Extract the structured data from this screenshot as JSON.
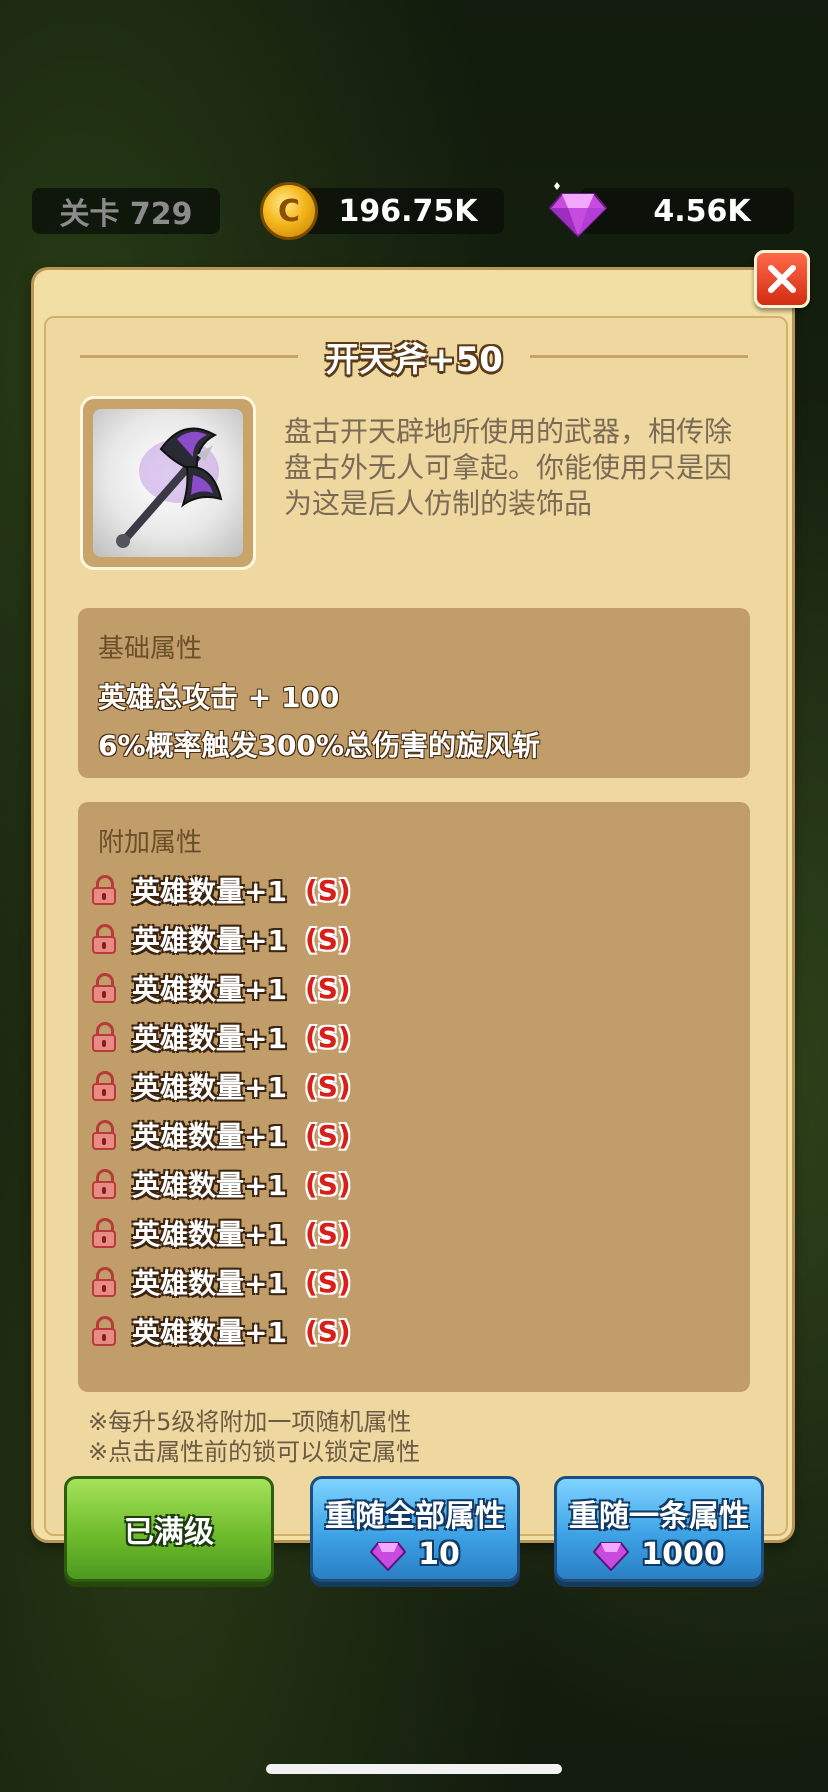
{
  "hud": {
    "level_label": "关卡 729",
    "coin_symbol": "C",
    "coins": "196.75K",
    "gems": "4.56K"
  },
  "dialog": {
    "title": "开天斧+50",
    "description": "盘古开天辟地所使用的武器，相传除盘古外无人可拿起。你能使用只是因为这是后人仿制的装饰品",
    "close_icon": "close-icon",
    "base_section": {
      "heading": "基础属性",
      "stats": [
        "英雄总攻击 + 100",
        "6%概率触发300%总伤害的旋风斩"
      ]
    },
    "extra_section": {
      "heading": "附加属性",
      "attributes": [
        {
          "text": "英雄数量+1",
          "grade": "(S)"
        },
        {
          "text": "英雄数量+1",
          "grade": "(S)"
        },
        {
          "text": "英雄数量+1",
          "grade": "(S)"
        },
        {
          "text": "英雄数量+1",
          "grade": "(S)"
        },
        {
          "text": "英雄数量+1",
          "grade": "(S)"
        },
        {
          "text": "英雄数量+1",
          "grade": "(S)"
        },
        {
          "text": "英雄数量+1",
          "grade": "(S)"
        },
        {
          "text": "英雄数量+1",
          "grade": "(S)"
        },
        {
          "text": "英雄数量+1",
          "grade": "(S)"
        },
        {
          "text": "英雄数量+1",
          "grade": "(S)"
        }
      ]
    },
    "notes": [
      "※每升5级将附加一项随机属性",
      "※点击属性前的锁可以锁定属性"
    ],
    "buttons": {
      "maxed": "已满级",
      "reroll_all": {
        "label": "重随全部属性",
        "cost": "10"
      },
      "reroll_one": {
        "label": "重随一条属性",
        "cost": "1000"
      }
    }
  },
  "colors": {
    "accent_red": "#d8201a",
    "panel": "#f2dfa3",
    "button_green": "#6fbd2c",
    "button_blue": "#3ea3e6"
  }
}
